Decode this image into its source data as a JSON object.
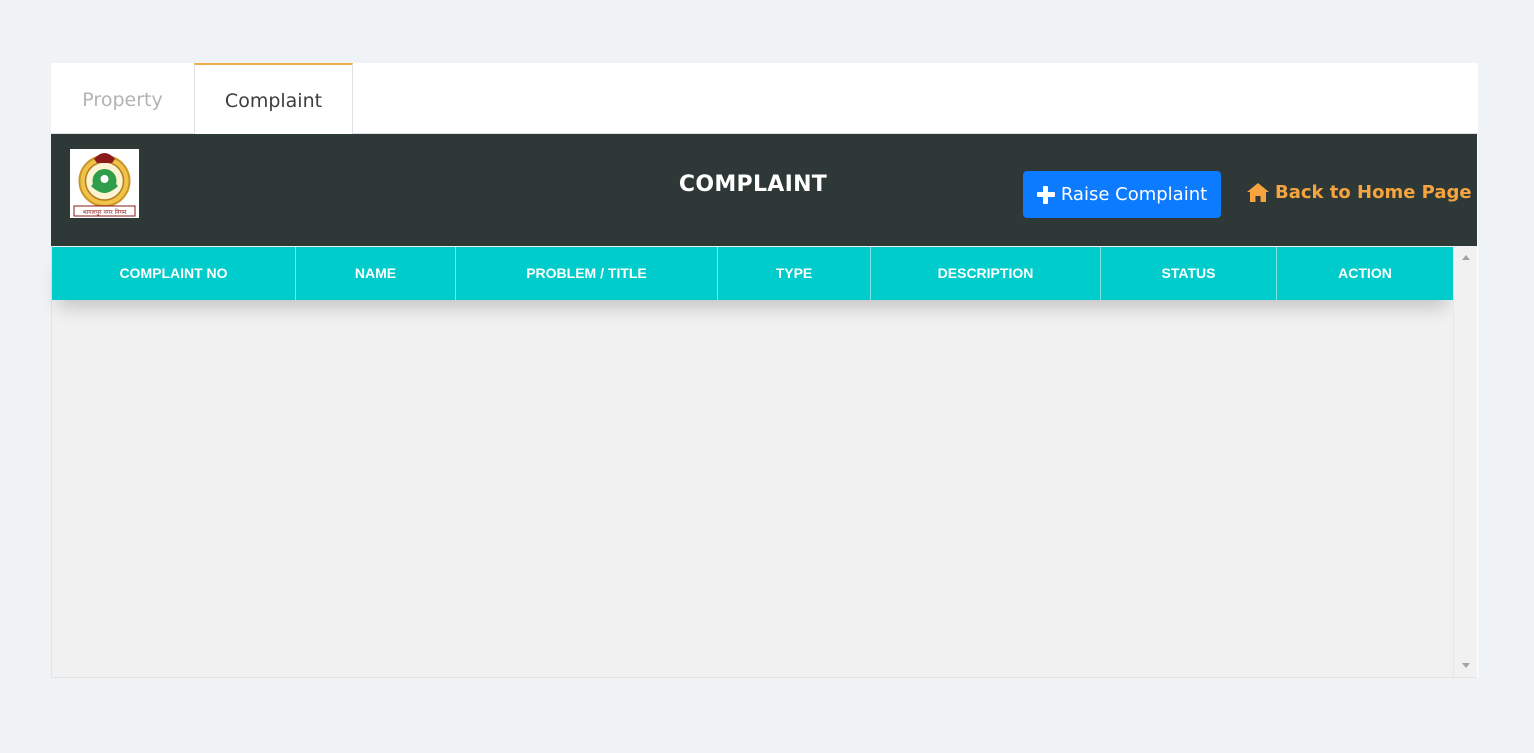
{
  "tabs": [
    {
      "label": "Property",
      "active": false
    },
    {
      "label": "Complaint",
      "active": true
    }
  ],
  "header": {
    "logo_text": "भागलपुर नगर निगम",
    "title": "COMPLAINT",
    "raise_button_label": "Raise Complaint",
    "home_link_label": "Back to Home Page"
  },
  "table": {
    "columns": [
      "COMPLAINT NO",
      "NAME",
      "PROBLEM / TITLE",
      "TYPE",
      "DESCRIPTION",
      "STATUS",
      "ACTION"
    ],
    "rows": []
  },
  "colors": {
    "accent_tab": "#f0ad4e",
    "header_bg": "#2e3836",
    "button_bg": "#0d7bff",
    "home_link": "#f5a43f",
    "table_header_bg": "#00cccc"
  },
  "icons": {
    "raise_button": "plus-icon",
    "home_link": "home-icon",
    "scroll_up": "scroll-up-arrow",
    "scroll_down": "scroll-down-arrow"
  }
}
